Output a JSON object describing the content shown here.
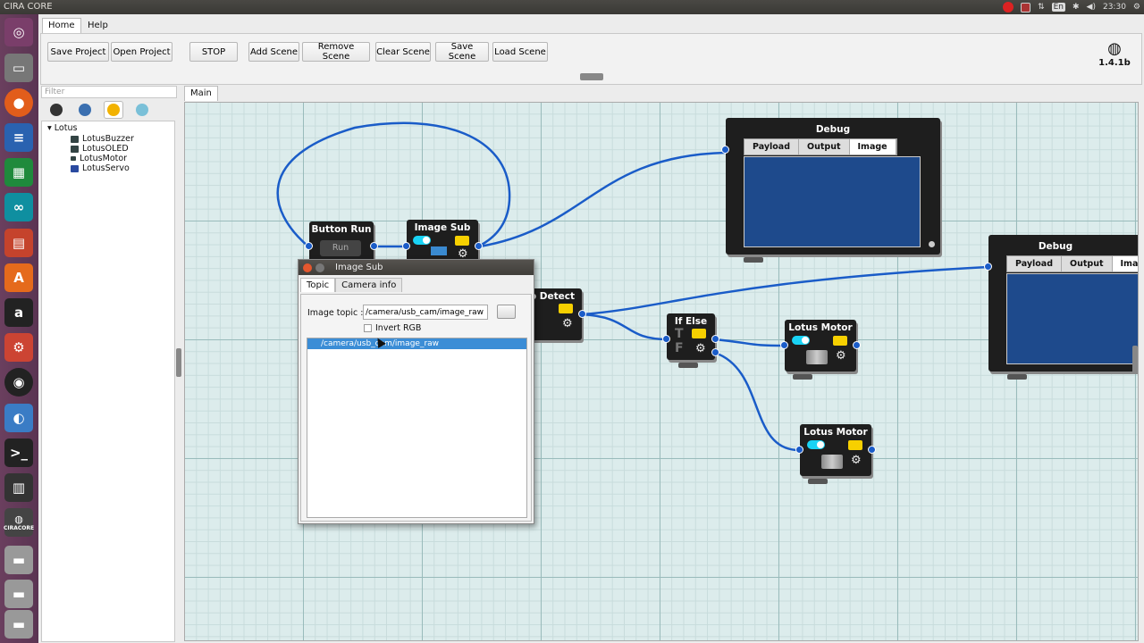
{
  "topbar": {
    "title": "CIRA CORE",
    "lang": "En",
    "time": "23:30"
  },
  "launcher": {
    "icons": [
      "ubuntu-dash-icon",
      "files-icon",
      "firefox-icon",
      "writer-icon",
      "calc-icon",
      "arduino-icon",
      "impress-icon",
      "software-center-icon",
      "amazon-icon",
      "settings-icon",
      "obs-icon",
      "browser-icon",
      "terminal-icon",
      "workspaces-icon",
      "ciracore-icon",
      "drive-icon",
      "drive-icon",
      "trash-icon"
    ],
    "ciracore_label": "CIRACORE"
  },
  "menu": {
    "home": "Home",
    "help": "Help"
  },
  "ribbon": {
    "save_project": "Save Project",
    "open_project": "Open Project",
    "stop": "STOP",
    "add_scene": "Add Scene",
    "remove_scene": "Remove Scene",
    "clear_scene": "Clear Scene",
    "save_scene": "Save Scene",
    "load_scene": "Load Scene",
    "version": "1.4.1b"
  },
  "library": {
    "filter_placeholder": "Filter",
    "root": "Lotus",
    "items": [
      "LotusBuzzer",
      "LotusOLED",
      "LotusMotor",
      "LotusServo"
    ]
  },
  "canvas": {
    "tab": "Main",
    "nodes": {
      "button_run": {
        "title": "Button Run",
        "button": "Run"
      },
      "image_sub": {
        "title": "Image Sub"
      },
      "detect": {
        "title": "p Detect"
      },
      "if_else": {
        "title": "If Else",
        "t": "T",
        "f": "F"
      },
      "motor1": {
        "title": "Lotus Motor"
      },
      "motor2": {
        "title": "Lotus Motor"
      },
      "debug1": {
        "title": "Debug",
        "tabs": [
          "Payload",
          "Output",
          "Image"
        ]
      },
      "debug2": {
        "title": "Debug",
        "tabs": [
          "Payload",
          "Output",
          "Ima"
        ]
      }
    }
  },
  "dialog": {
    "title": "Image Sub",
    "tabs": [
      "Topic",
      "Camera info"
    ],
    "topic_label": "Image topic :",
    "topic_value": "/camera/usb_cam/image_raw",
    "invert_label": "Invert RGB",
    "list_items": [
      "/camera/usb_cam/image_raw"
    ]
  },
  "colors": {
    "accent": "#1a5cc8",
    "toggle": "#19d3f5",
    "yellow": "#f7d000",
    "node": "#1e1e1e",
    "debug_view": "#1e4a8c",
    "selection": "#3b8dd6"
  }
}
